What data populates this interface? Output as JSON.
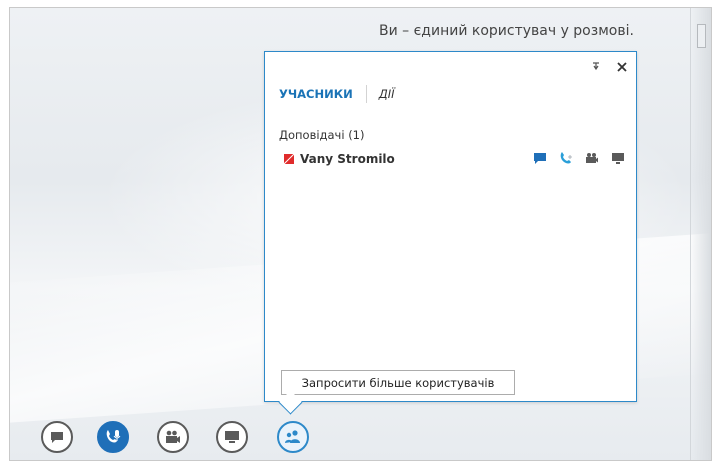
{
  "status_message": "Ви – єдиний користувач у розмові.",
  "popup": {
    "tabs": [
      {
        "label": "УЧАСНИКИ",
        "active": true
      },
      {
        "label": "ДІЇ",
        "active": false
      }
    ],
    "section_title": "Доповідачі (1)",
    "participant": {
      "name": "Vany Stromilo",
      "presence_color": "#e02b2b",
      "actions": [
        "im-icon",
        "phone-icon",
        "video-icon",
        "screen-icon"
      ]
    },
    "invite_button_label": "Запросити більше користувачів"
  },
  "toolbar": {
    "buttons": [
      "im-icon",
      "microphone-icon",
      "video-icon",
      "present-icon",
      "participants-icon"
    ]
  },
  "colors": {
    "accent": "#1f6fb8",
    "popup_border": "#2d89c9",
    "presence_busy": "#e02b2b"
  }
}
